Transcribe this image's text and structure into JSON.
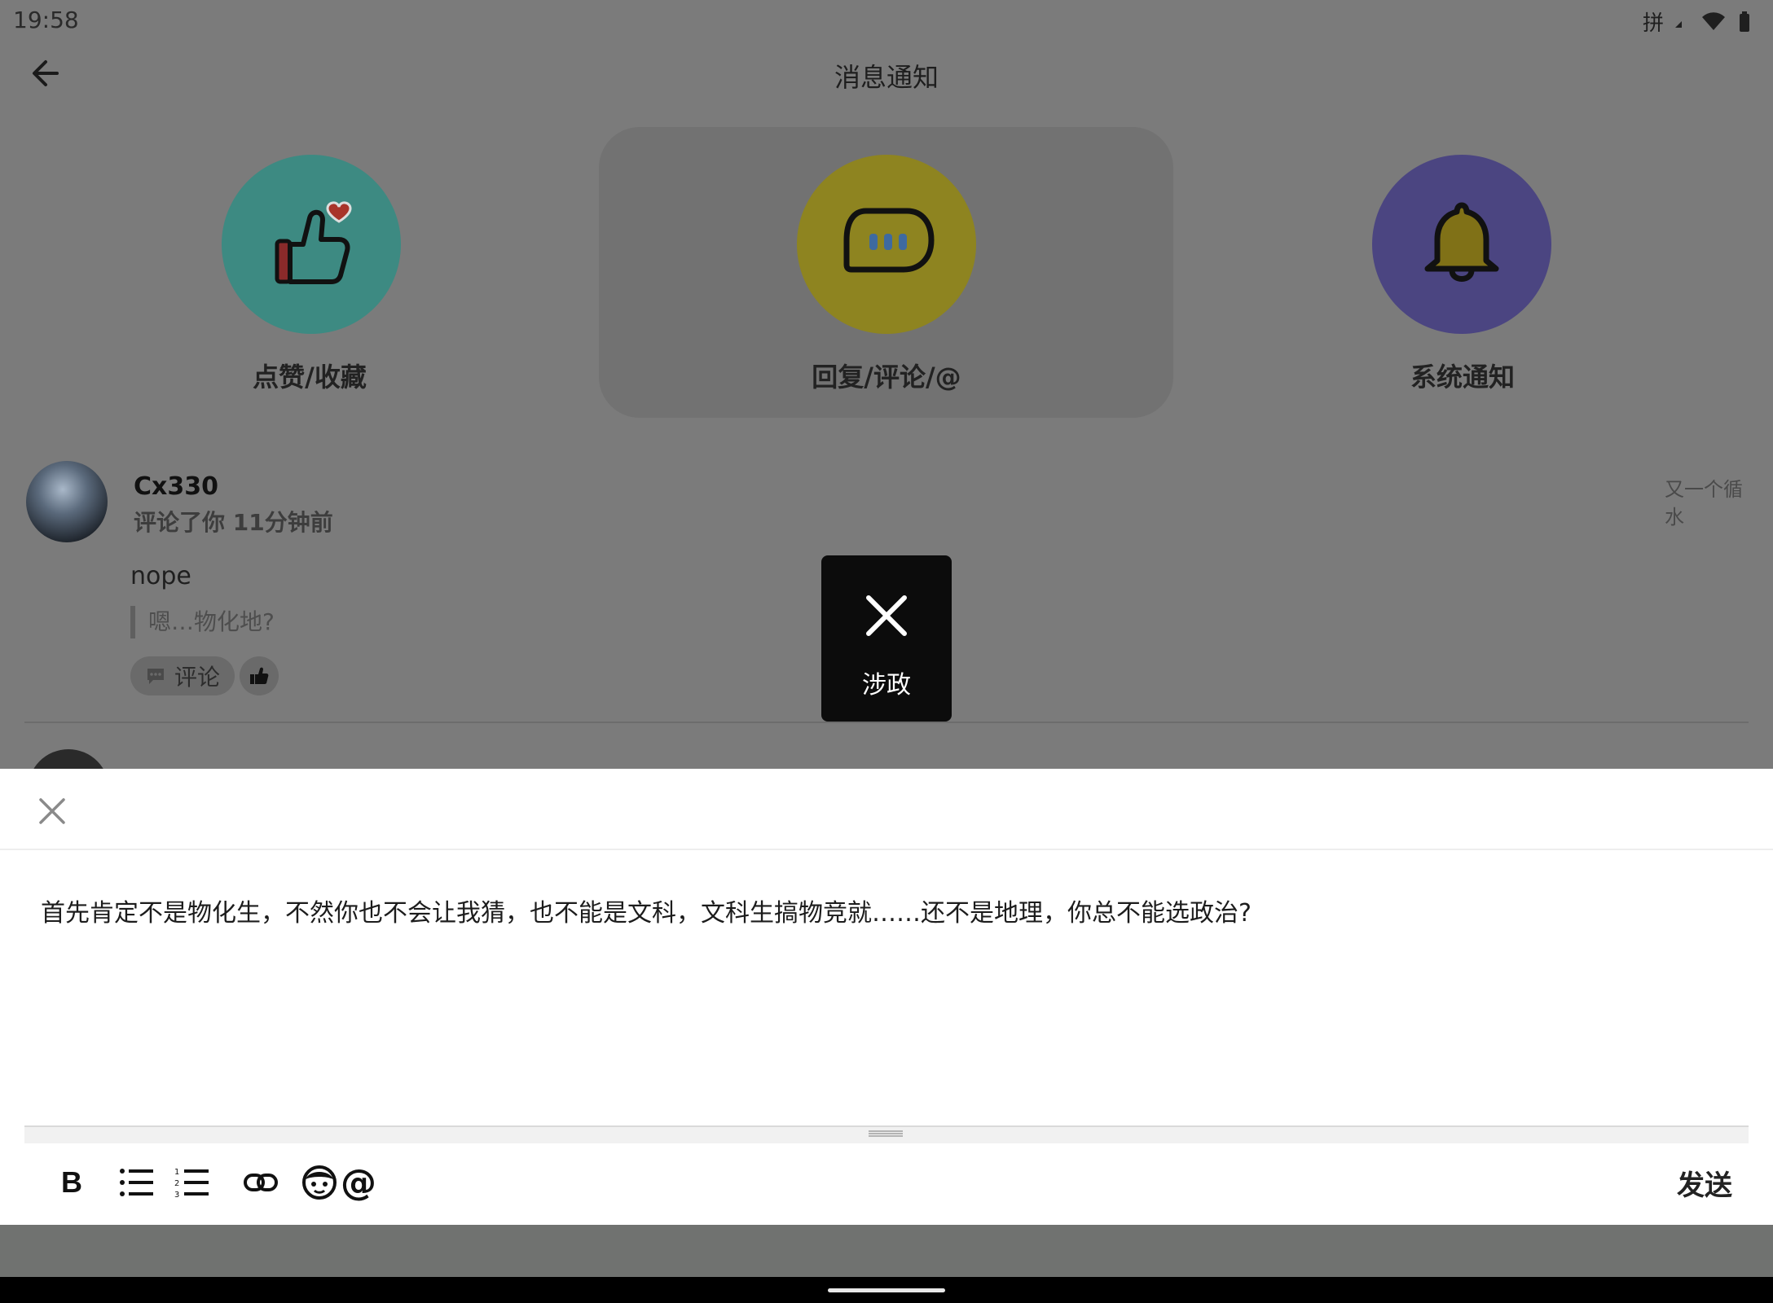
{
  "status": {
    "time": "19:58",
    "ime": "拼"
  },
  "header": {
    "title": "消息通知"
  },
  "categories": [
    {
      "label": "点赞/收藏",
      "color": "#3d8a82"
    },
    {
      "label": "回复/评论/@",
      "color": "#8e8420"
    },
    {
      "label": "系统通知",
      "color": "#4b4581"
    }
  ],
  "message": {
    "username": "Cx330",
    "subline": "评论了你 11分钟前",
    "right_note": "又一个循水",
    "text": "nope",
    "quote": "嗯…物化地?",
    "comment_label": "评论"
  },
  "toast": {
    "label": "涉政"
  },
  "composer": {
    "text": "首先肯定不是物化生，不然你也不会让我猜，也不能是文科，文科生搞物竞就……还不是地理，你总不能选政治?",
    "send_label": "发送"
  }
}
